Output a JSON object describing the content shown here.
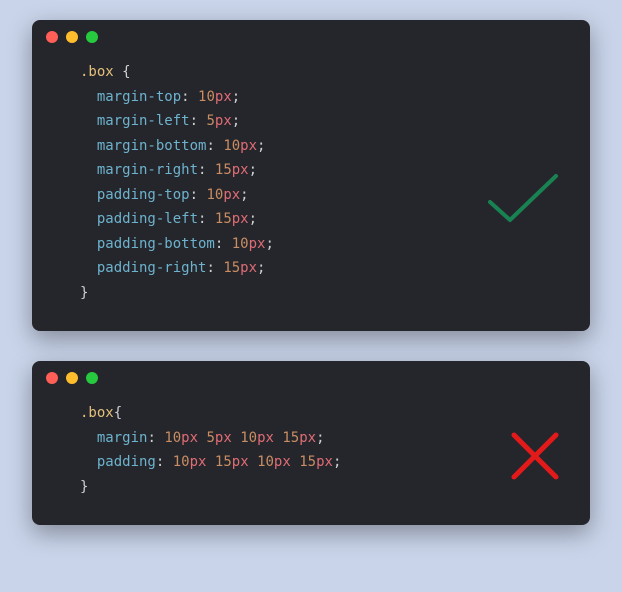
{
  "goodBlock": {
    "selector": ".box",
    "braceOpen": "{",
    "braceClose": "}",
    "decls": [
      {
        "prop": "margin-top",
        "num": "10",
        "unit": "px"
      },
      {
        "prop": "margin-left",
        "num": "5",
        "unit": "px"
      },
      {
        "prop": "margin-bottom",
        "num": "10",
        "unit": "px"
      },
      {
        "prop": "margin-right",
        "num": "15",
        "unit": "px"
      },
      {
        "prop": "padding-top",
        "num": "10",
        "unit": "px"
      },
      {
        "prop": "padding-left",
        "num": "15",
        "unit": "px"
      },
      {
        "prop": "padding-bottom",
        "num": "10",
        "unit": "px"
      },
      {
        "prop": "padding-right",
        "num": "15",
        "unit": "px"
      }
    ]
  },
  "badBlock": {
    "selector": ".box",
    "braceOpen": "{",
    "braceClose": "}",
    "decls": [
      {
        "prop": "margin",
        "vals": [
          {
            "num": "10",
            "unit": "px"
          },
          {
            "num": "5",
            "unit": "px"
          },
          {
            "num": "10",
            "unit": "px"
          },
          {
            "num": "15",
            "unit": "px"
          }
        ]
      },
      {
        "prop": "padding",
        "vals": [
          {
            "num": "10",
            "unit": "px"
          },
          {
            "num": "15",
            "unit": "px"
          },
          {
            "num": "10",
            "unit": "px"
          },
          {
            "num": "15",
            "unit": "px"
          }
        ]
      }
    ]
  },
  "marks": {
    "checkColor": "#198253",
    "crossColor": "#e41a1a"
  }
}
